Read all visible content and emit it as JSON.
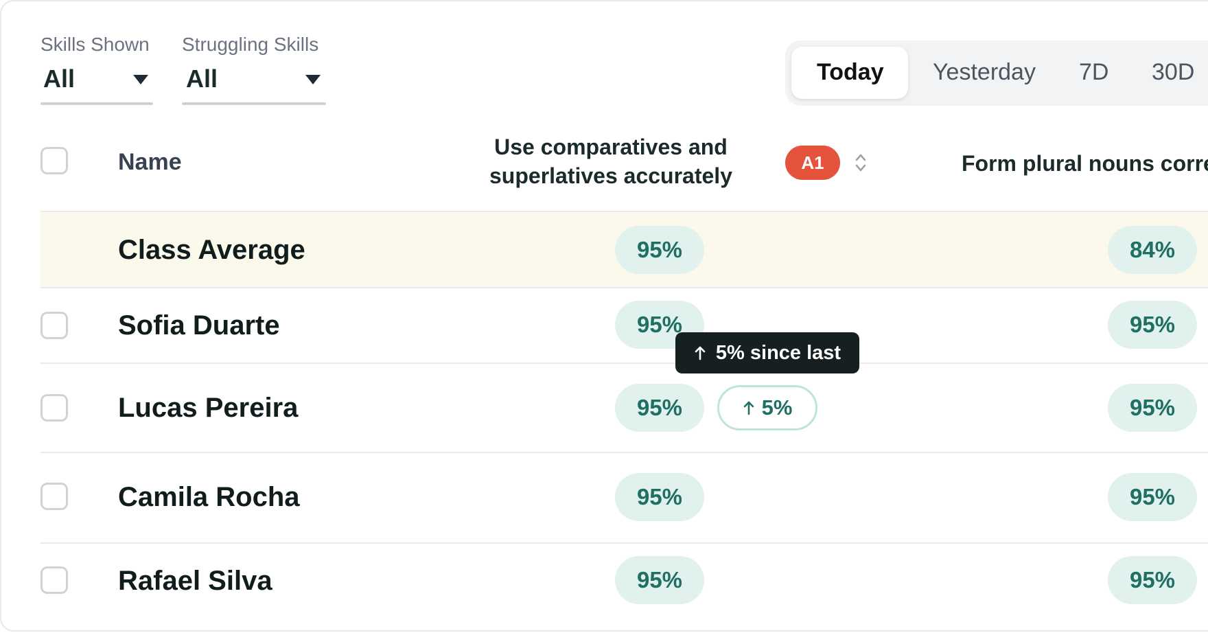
{
  "filters": {
    "skills_shown": {
      "label": "Skills Shown",
      "value": "All"
    },
    "struggling_skills": {
      "label": "Struggling Skills",
      "value": "All"
    }
  },
  "time_range": {
    "options": [
      "Today",
      "Yesterday",
      "7D",
      "30D"
    ],
    "selected": "Today"
  },
  "table": {
    "header": {
      "name": "Name",
      "skill1_line1": "Use comparatives and",
      "skill1_line2": "superlatives accurately",
      "skill1_level": "A1",
      "skill2": "Form plural nouns corre"
    },
    "class_average": {
      "label": "Class Average",
      "skill1": "95%",
      "skill2": "84%"
    },
    "students": [
      {
        "name": "Sofia Duarte",
        "skill1": "95%",
        "skill2": "95%"
      },
      {
        "name": "Lucas Pereira",
        "skill1": "95%",
        "skill2": "95%",
        "delta": "5%"
      },
      {
        "name": "Camila Rocha",
        "skill1": "95%",
        "skill2": "95%"
      },
      {
        "name": "Rafael Silva",
        "skill1": "95%",
        "skill2": "95%"
      }
    ]
  },
  "tooltip": {
    "text": "5% since last"
  },
  "colors": {
    "pill_bg": "#e1f1ee",
    "pill_text": "#1f6f63",
    "level_badge": "#e5533d",
    "class_average_bg": "#fbf9ec",
    "tooltip_bg": "#162020"
  },
  "icons": {
    "dropdown": "caret-down-icon",
    "sort": "sort-icon",
    "trend": "arrow-up-icon"
  }
}
